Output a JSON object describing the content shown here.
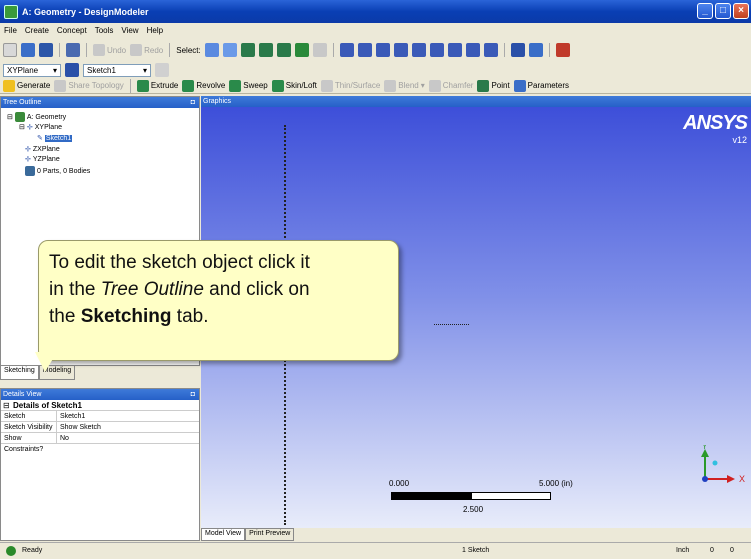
{
  "window": {
    "title": "A: Geometry - DesignModeler"
  },
  "menu": [
    "File",
    "Create",
    "Concept",
    "Tools",
    "View",
    "Help"
  ],
  "toolbar1": {
    "undo_label": "Undo",
    "redo_label": "Redo",
    "select_label": "Select:"
  },
  "plane_combo": {
    "value": "XYPlane"
  },
  "sketch_combo": {
    "value": "Sketch1"
  },
  "toolbar3": {
    "generate": "Generate",
    "share_topology": "Share Topology",
    "extrude": "Extrude",
    "revolve": "Revolve",
    "sweep": "Sweep",
    "skinloft": "Skin/Loft",
    "thin_surface": "Thin/Surface",
    "blend": "Blend",
    "chamfer": "Chamfer",
    "point": "Point",
    "parameters": "Parameters"
  },
  "tree": {
    "title": "Tree Outline",
    "items": [
      {
        "label": "A: Geometry"
      },
      {
        "label": "XYPlane"
      },
      {
        "label": "Sketch1"
      },
      {
        "label": "ZXPlane"
      },
      {
        "label": "YZPlane"
      },
      {
        "label": "0 Parts, 0 Bodies"
      }
    ]
  },
  "tabs": {
    "sketching": "Sketching",
    "modeling": "Modeling"
  },
  "details": {
    "title": "Details View",
    "group": "Details of Sketch1",
    "rows": [
      {
        "key": "Sketch",
        "value": "Sketch1"
      },
      {
        "key": "Sketch Visibility",
        "value": "Show Sketch"
      },
      {
        "key": "Show Constraints?",
        "value": "No"
      }
    ]
  },
  "graphics": {
    "title": "Graphics",
    "brand": "ANSYS",
    "version": "v12",
    "scale": {
      "left": "0.000",
      "right": "5.000 (in)",
      "mid": "2.500"
    },
    "tabs": {
      "model_view": "Model View",
      "print_preview": "Print Preview"
    },
    "triad": {
      "y": "Y",
      "x": "X"
    }
  },
  "callout": {
    "line1": "To edit the sketch object click it",
    "line2_pre": "in the ",
    "line2_em": "Tree Outline",
    "line2_post": " and click on",
    "line3_pre": "the ",
    "line3_strong": "Sketching",
    "line3_post": " tab."
  },
  "status": {
    "ready": "Ready",
    "selection": "1 Sketch",
    "units": "Inch",
    "v1": "0",
    "v2": "0"
  },
  "colors": {
    "title_blue": "#0a3fb4",
    "viewport_top": "#3d4fd9",
    "viewport_bottom": "#e8ecfa",
    "callout_bg": "#ffffc6",
    "selection": "#316ac5"
  }
}
